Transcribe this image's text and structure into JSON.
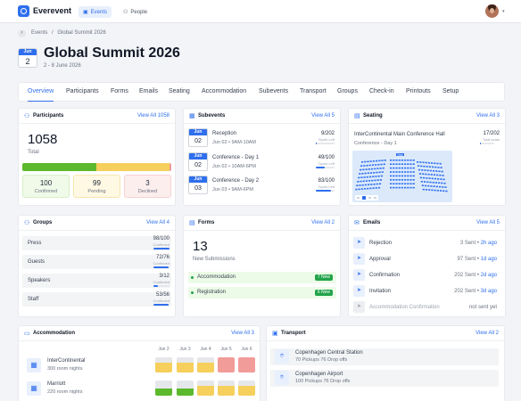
{
  "app": {
    "name": "Everevent",
    "nav": [
      {
        "label": "Events",
        "active": true
      },
      {
        "label": "People",
        "active": false
      }
    ],
    "accent": "#2f6fed"
  },
  "breadcrumb": {
    "root": "Events",
    "sep": "/",
    "current": "Global Summit 2026"
  },
  "event": {
    "month": "Jun",
    "day": "2",
    "title": "Global Summit 2026",
    "dates": "2 - 8 June 2026"
  },
  "tabs": [
    "Overview",
    "Participants",
    "Forms",
    "Emails",
    "Seating",
    "Accommodation",
    "Subevents",
    "Transport",
    "Groups",
    "Check-in",
    "Printouts",
    "Setup"
  ],
  "participants": {
    "title": "Participants",
    "link": "View All 1058",
    "total": "1058",
    "total_label": "Total",
    "stats": [
      {
        "value": "100",
        "label": "Confirmed",
        "color": "#5cb82c"
      },
      {
        "value": "99",
        "label": "Pending",
        "color": "#f6cf5c"
      },
      {
        "value": "3",
        "label": "Declined",
        "color": "#f29c99"
      }
    ]
  },
  "subevents": {
    "title": "Subevents",
    "link": "View All 5",
    "items": [
      {
        "month": "Jun",
        "day": "02",
        "name": "Reception",
        "meta": "Jun 02 • 9AM-10AM",
        "count": "9/202",
        "sub": "Spots Left",
        "fill": 0.04
      },
      {
        "month": "Jun",
        "day": "02",
        "name": "Conference - Day 1",
        "meta": "Jun 02 • 10AM-6PM",
        "count": "49/100",
        "sub": "Spots Left",
        "fill": 0.49
      },
      {
        "month": "Jun",
        "day": "03",
        "name": "Conference - Day 2",
        "meta": "Jun 03 • 9AM-6PM",
        "count": "83/100",
        "sub": "Spots Left",
        "fill": 0.83
      }
    ]
  },
  "seating": {
    "title": "Seating",
    "link": "View All 3",
    "venue": "InterContinental Main Conference Hall",
    "sub": "Conference - Day 1",
    "count": "17/202",
    "count_sub": "Total seats",
    "fill": 0.08,
    "map_label": "Stage"
  },
  "groups": {
    "title": "Groups",
    "link": "View All 4",
    "items": [
      {
        "name": "Press",
        "count": "98/100",
        "sub": "Confirmed",
        "fill": 0.98
      },
      {
        "name": "Guests",
        "count": "72/76",
        "sub": "Confirmed",
        "fill": 0.95
      },
      {
        "name": "Speakers",
        "count": "3/12",
        "sub": "Confirmed",
        "fill": 0.25
      },
      {
        "name": "Staff",
        "count": "53/56",
        "sub": "Confirmed",
        "fill": 0.95
      }
    ]
  },
  "forms": {
    "title": "Forms",
    "link": "View All 2",
    "count": "13",
    "count_label": "New Submissions",
    "items": [
      {
        "name": "Accommodation",
        "badge": "7 New"
      },
      {
        "name": "Registration",
        "badge": "6 New"
      }
    ]
  },
  "emails": {
    "title": "Emails",
    "link": "View All 5",
    "items": [
      {
        "name": "Rejection",
        "sent": "3 Sent",
        "sep": " • ",
        "when": "2h ago",
        "dim": false
      },
      {
        "name": "Approval",
        "sent": "97 Sent",
        "sep": " • ",
        "when": "1d ago",
        "dim": false
      },
      {
        "name": "Confirmation",
        "sent": "202 Sent",
        "sep": " • ",
        "when": "2d ago",
        "dim": false
      },
      {
        "name": "Invitation",
        "sent": "202 Sent",
        "sep": " • ",
        "when": "3d ago",
        "dim": false
      },
      {
        "name": "Accommodation Confirmation",
        "sent": "not sent yet",
        "sep": "",
        "when": "",
        "dim": true
      }
    ]
  },
  "accommodation": {
    "title": "Accommodation",
    "link": "View All 3",
    "days": [
      "Jun 2",
      "Jun 3",
      "Jun 4",
      "Jun 5",
      "Jun 6"
    ],
    "hotels": [
      {
        "name": "InterContinental",
        "nights": "300 room nights",
        "cells": [
          "yellow",
          "yellow",
          "yellow",
          "red",
          "red"
        ]
      },
      {
        "name": "Marriott",
        "nights": "220 room nights",
        "cells": [
          "green",
          "green",
          "yellow",
          "yellow",
          "yellow"
        ]
      }
    ],
    "colors": {
      "green": "#5cb82c",
      "yellow": "#f6cf5c",
      "red": "#f29c99",
      "empty": "#e5e7eb"
    }
  },
  "transport": {
    "title": "Transport",
    "link": "View All 2",
    "items": [
      {
        "name": "Copenhagen Central Station",
        "meta": "70 Pickups  76 Drop offs"
      },
      {
        "name": "Copenhagen Airport",
        "meta": "100 Pickups  76 Drop offs"
      }
    ]
  }
}
